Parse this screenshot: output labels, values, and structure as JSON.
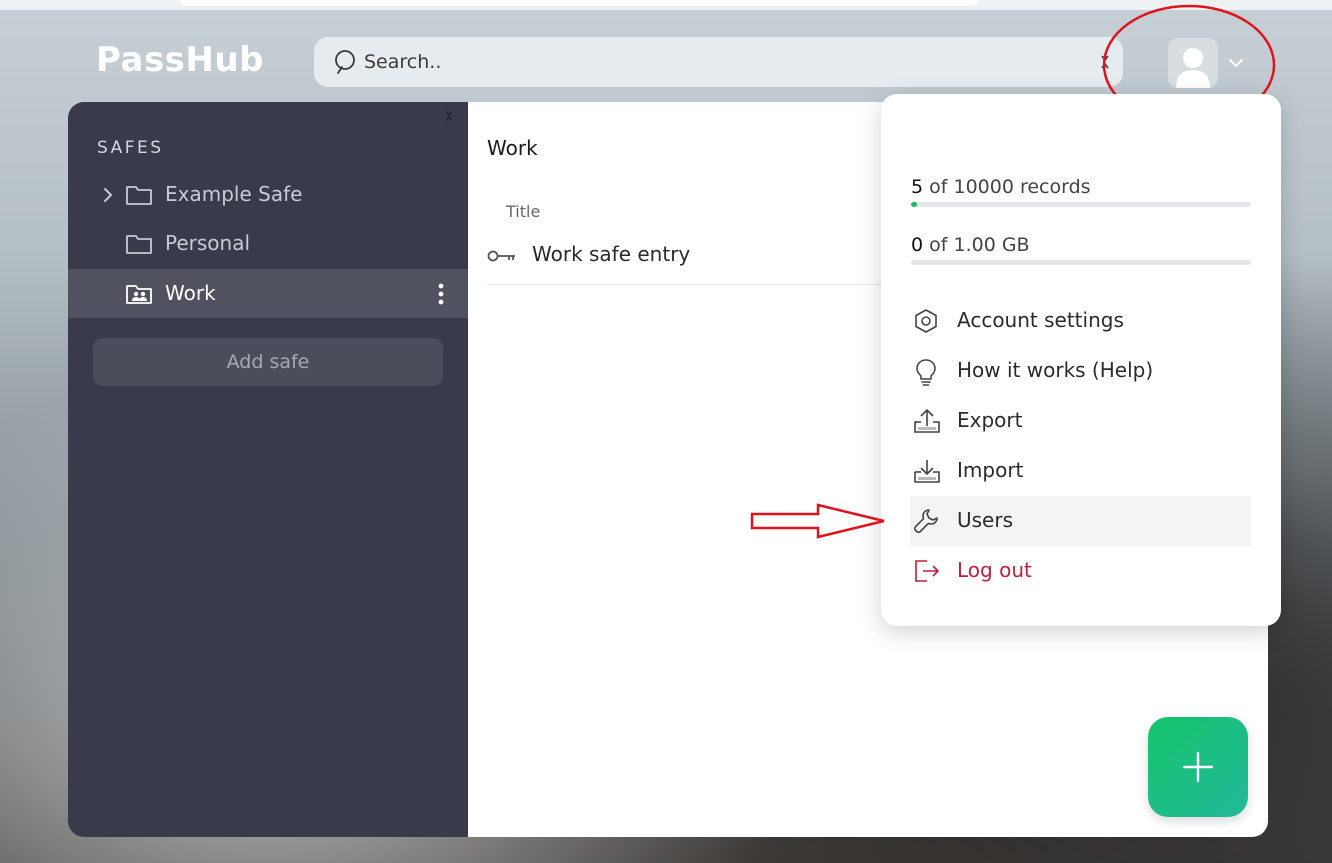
{
  "app": {
    "logo": "PassHub"
  },
  "search": {
    "placeholder": "Search.."
  },
  "sidebar": {
    "title": "SAFES",
    "safes": [
      {
        "label": "Example Safe",
        "has_children": true,
        "shared": false
      },
      {
        "label": "Personal",
        "has_children": false,
        "shared": false
      },
      {
        "label": "Work",
        "has_children": false,
        "shared": true,
        "active": true
      }
    ],
    "add_safe_label": "Add safe"
  },
  "main": {
    "title": "Work",
    "column_title": "Title",
    "entries": [
      {
        "label": "Work safe entry",
        "icon": "key-icon"
      }
    ]
  },
  "account_menu": {
    "records": {
      "used": "5",
      "text": " of 10000 records",
      "fraction": 0.0005
    },
    "storage": {
      "used": "0",
      "text": " of 1.00 GB",
      "fraction": 0
    },
    "items": [
      {
        "label": "Account settings",
        "icon": "settings-hex-icon"
      },
      {
        "label": "How it works (Help)",
        "icon": "lightbulb-icon"
      },
      {
        "label": "Export",
        "icon": "export-icon"
      },
      {
        "label": "Import",
        "icon": "import-icon"
      },
      {
        "label": "Users",
        "icon": "wrench-icon",
        "highlighted": true
      },
      {
        "label": "Log out",
        "icon": "logout-icon",
        "danger": true
      }
    ]
  },
  "colors": {
    "sidebar_bg": "#3a3b4a",
    "active_safe_bg": "#51525f",
    "accent_green": "#1fb86b",
    "logout_red": "#c11f3d",
    "annotation_red": "#e0141e"
  }
}
